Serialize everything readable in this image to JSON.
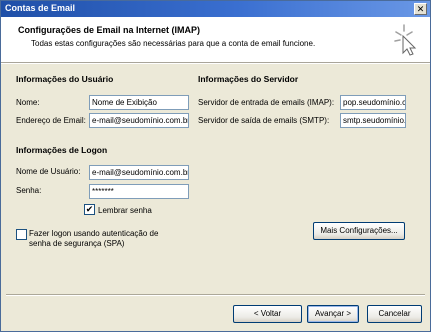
{
  "window": {
    "title": "Contas de Email",
    "close_glyph": "✕"
  },
  "header": {
    "title": "Configurações de Email na Internet (IMAP)",
    "subtitle": "Todas estas configurações são necessárias para que a conta de email funcione."
  },
  "user_info": {
    "heading": "Informações do Usuário",
    "name_label": "Nome:",
    "name_value": "Nome de Exibição",
    "email_label": "Endereço de Email:",
    "email_value": "e-mail@seudomínio.com.br"
  },
  "server_info": {
    "heading": "Informações do Servidor",
    "incoming_label": "Servidor de entrada de emails (IMAP):",
    "incoming_value": "pop.seudomínio.c",
    "outgoing_label": "Servidor de saída de emails (SMTP):",
    "outgoing_value": "smtp.seudomínio."
  },
  "logon_info": {
    "heading": "Informações de Logon",
    "username_label": "Nome de Usuário:",
    "username_value": "e-mail@seudomínio.com.br",
    "password_label": "Senha:",
    "password_value": "*******",
    "remember_label": "Lembrar senha",
    "remember_checked": true,
    "spa_label_line1": "Fazer logon usando autenticação de",
    "spa_label_line2": "senha de segurança (SPA)",
    "spa_checked": false
  },
  "more_settings_label": "Mais Configurações...",
  "footer": {
    "back_label": "< Voltar",
    "next_label": "Avançar >",
    "cancel_label": "Cancelar"
  },
  "colors": {
    "title_bar": "#1f4fa8",
    "dialog_bg": "#ece9d8",
    "field_border": "#7f9db9"
  },
  "icons": {
    "wizard": "sparkle-cursor-icon",
    "check": "checkmark-icon"
  }
}
